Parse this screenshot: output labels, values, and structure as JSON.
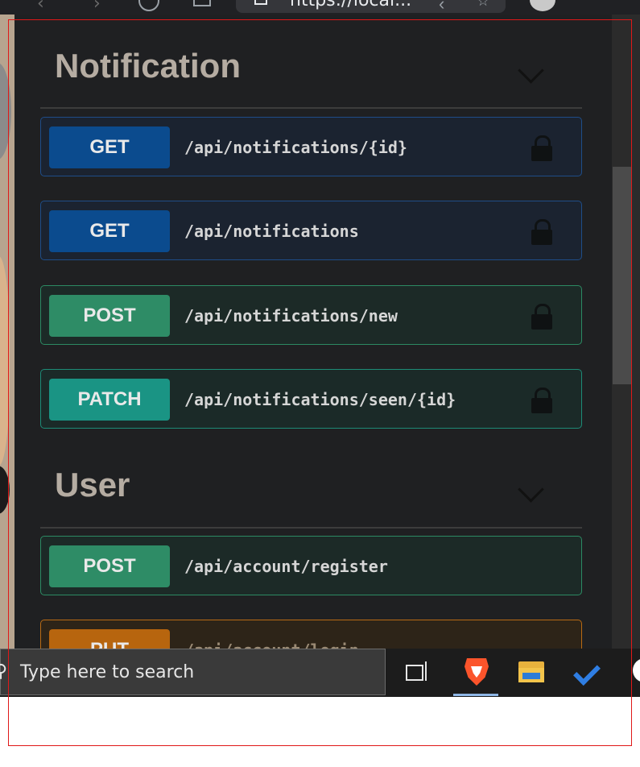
{
  "browser": {
    "url_text": "https://local..."
  },
  "sections": [
    {
      "title": "Notification",
      "operations": [
        {
          "method": "GET",
          "path": "/api/notifications/{id}"
        },
        {
          "method": "GET",
          "path": "/api/notifications"
        },
        {
          "method": "POST",
          "path": "/api/notifications/new"
        },
        {
          "method": "PATCH",
          "path": "/api/notifications/seen/{id}"
        }
      ]
    },
    {
      "title": "User",
      "operations": [
        {
          "method": "POST",
          "path": "/api/account/register"
        },
        {
          "method": "PUT",
          "path": "/api/account/login"
        }
      ]
    }
  ],
  "taskbar": {
    "search_placeholder": "Type here to search"
  },
  "colors": {
    "get": "#0b4b8e",
    "post": "#2e8c66",
    "patch": "#1a9484",
    "put": "#b7650e",
    "frame": "#e01818"
  }
}
